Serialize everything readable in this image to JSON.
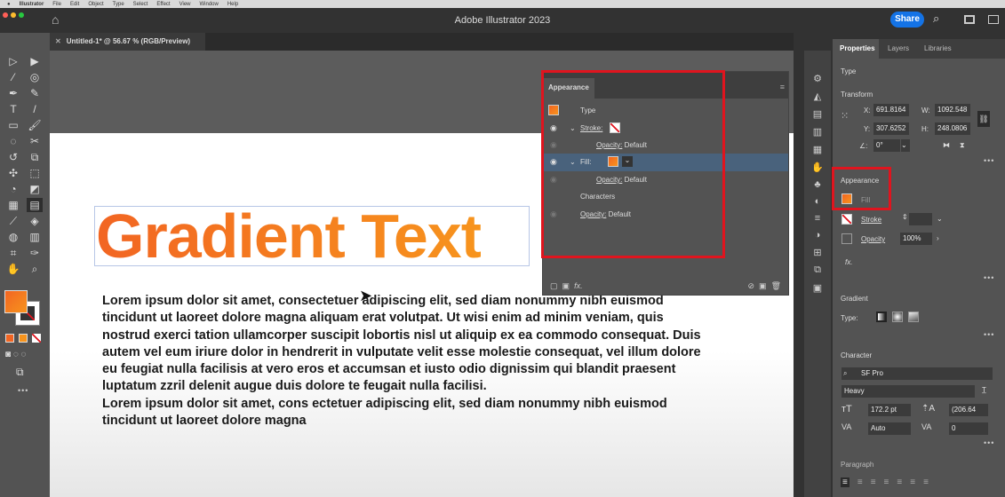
{
  "menubar": {
    "apple": "",
    "items": [
      "Illustrator",
      "File",
      "Edit",
      "Object",
      "Type",
      "Select",
      "Effect",
      "View",
      "Window",
      "Help"
    ]
  },
  "titlebar": {
    "title": "Adobe Illustrator 2023",
    "share": "Share"
  },
  "doc_tab": {
    "label": "Untitled-1* @ 56.67 % (RGB/Preview)"
  },
  "canvas": {
    "headline": "Gradient Text",
    "paragraph1": "Lorem ipsum dolor sit amet, consectetuer adipiscing elit, sed diam nonummy nibh euismod tincidunt ut laoreet dolore magna aliquam erat volutpat. Ut wisi enim ad minim veniam, quis nostrud exerci tation ullamcorper suscipit lobortis nisl ut aliquip ex ea commodo consequat. Duis autem vel eum iriure dolor in hendrerit in vulputate velit esse molestie consequat, vel illum dolore eu feugiat nulla facilisis at vero eros et accumsan et iusto odio dignissim qui blandit praesent luptatum zzril delenit augue duis dolore te feugait nulla facilisi.",
    "paragraph2": "Lorem ipsum dolor sit amet, cons ectetuer adipiscing elit, sed diam nonummy nibh euismod tincidunt ut laoreet dolore magna"
  },
  "appearance_panel": {
    "title": "Appearance",
    "type": "Type",
    "stroke": "Stroke:",
    "opacity": "Opacity:",
    "default": "Default",
    "fill": "Fill:",
    "characters": "Characters",
    "fx": "fx."
  },
  "properties": {
    "tabs": [
      "Properties",
      "Layers",
      "Libraries"
    ],
    "type": "Type",
    "transform": "Transform",
    "x_label": "X:",
    "x": "691.8164",
    "y_label": "Y:",
    "y": "307.6252",
    "w_label": "W:",
    "w": "1092.548",
    "h_label": "H:",
    "h": "248.0806",
    "angle_label": "∠:",
    "angle": "0°",
    "appearance": "Appearance",
    "fill": "Fill",
    "stroke": "Stroke",
    "opacity": "Opacity",
    "opacity_value": "100%",
    "fx": "fx.",
    "gradient": "Gradient",
    "gradient_type": "Type:",
    "character": "Character",
    "font": "SF Pro",
    "style": "Heavy",
    "size": "172.2 pt",
    "leading": "(206.64",
    "kerning": "Auto",
    "tracking": "0",
    "paragraph": "Paragraph",
    "more": "•••"
  },
  "colors": {
    "accent": "#1473e6",
    "fill_start": "#f26522",
    "fill_end": "#f7941d",
    "highlight": "#e0141e"
  }
}
